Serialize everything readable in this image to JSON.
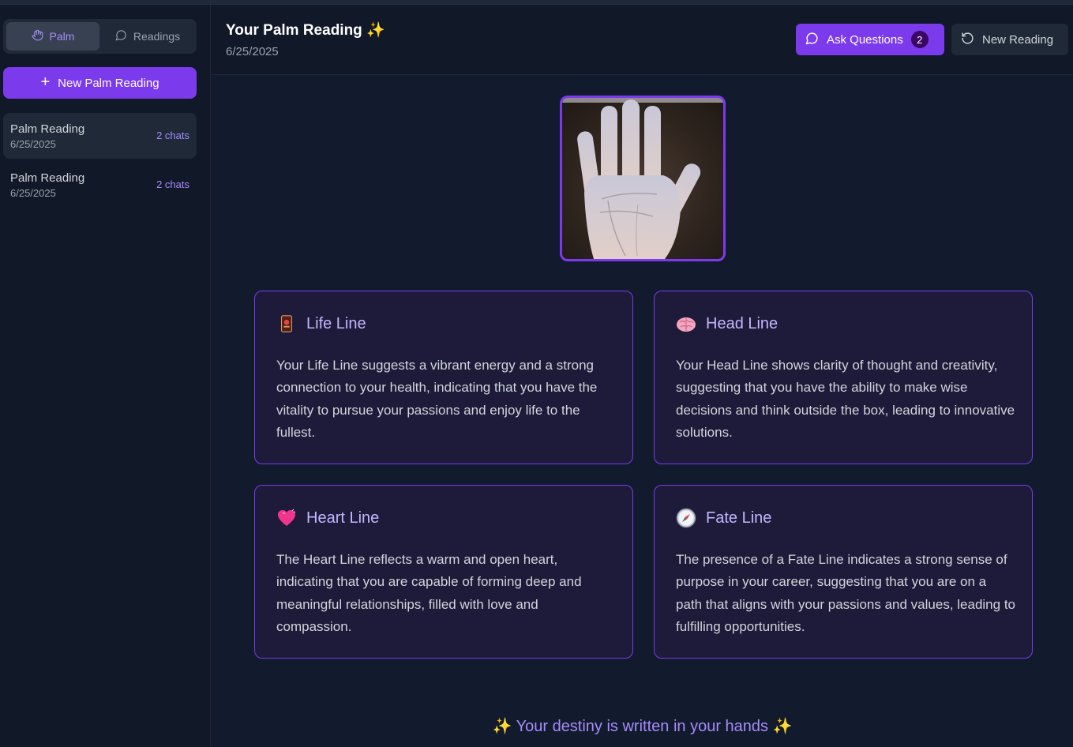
{
  "sidebar": {
    "tabs": [
      {
        "label": "Palm",
        "icon": "hand-icon",
        "active": true
      },
      {
        "label": "Readings",
        "icon": "chat-bubble-icon",
        "active": false
      }
    ],
    "new_button": "New Palm Reading",
    "readings": [
      {
        "title": "Palm Reading",
        "date": "6/25/2025",
        "chats": "2 chats",
        "selected": true
      },
      {
        "title": "Palm Reading",
        "date": "6/25/2025",
        "chats": "2 chats",
        "selected": false
      }
    ]
  },
  "header": {
    "title": "Your Palm Reading ✨",
    "date": "6/25/2025",
    "ask_button": "Ask Questions",
    "ask_badge": "2",
    "new_reading_button": "New Reading"
  },
  "colors": {
    "accent": "#7c3aed",
    "accent_text": "#a78bfa",
    "background": "#111827",
    "card_bg": "#1e1b3a"
  },
  "lines": [
    {
      "icon": "tarot-card-icon",
      "title": "Life Line",
      "text": "Your Life Line suggests a vibrant energy and a strong connection to your health, indicating that you have the vitality to pursue your passions and enjoy life to the fullest."
    },
    {
      "icon": "brain-icon",
      "title": "Head Line",
      "text": "Your Head Line shows clarity of thought and creativity, suggesting that you have the ability to make wise decisions and think outside the box, leading to innovative solutions."
    },
    {
      "icon": "pink-heart-icon",
      "title": "Heart Line",
      "text": "The Heart Line reflects a warm and open heart, indicating that you are capable of forming deep and meaningful relationships, filled with love and compassion."
    },
    {
      "icon": "compass-icon",
      "title": "Fate Line",
      "text": "The presence of a Fate Line indicates a strong sense of purpose in your career, suggesting that you are on a path that aligns with your passions and values, leading to fulfilling opportunities."
    }
  ],
  "footer": "✨ Your destiny is written in your hands ✨"
}
